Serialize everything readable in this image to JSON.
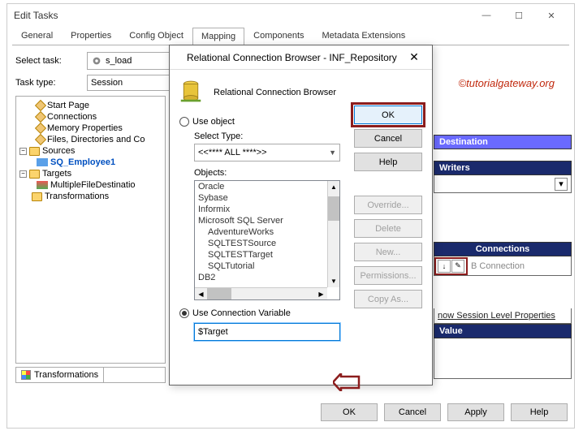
{
  "window": {
    "title": "Edit Tasks",
    "minimize": "—",
    "maximize": "☐",
    "close": "✕"
  },
  "tabs": [
    "General",
    "Properties",
    "Config Object",
    "Mapping",
    "Components",
    "Metadata Extensions"
  ],
  "active_tab": 3,
  "select_task": {
    "label": "Select task:",
    "value": "s_load"
  },
  "task_type": {
    "label": "Task type:",
    "value": "Session"
  },
  "tree": {
    "items": [
      {
        "label": "Start Page",
        "icon": "diamond",
        "indent": 1
      },
      {
        "label": "Connections",
        "icon": "diamond",
        "indent": 1
      },
      {
        "label": "Memory Properties",
        "icon": "diamond",
        "indent": 1
      },
      {
        "label": "Files, Directories and Co",
        "icon": "diamond",
        "indent": 1
      },
      {
        "label": "Sources",
        "icon": "folder",
        "indent": 0,
        "exp": "-"
      },
      {
        "label": "SQ_Employee1",
        "icon": "sq",
        "indent": 1,
        "blue": true
      },
      {
        "label": "Targets",
        "icon": "folder",
        "indent": 0,
        "exp": "-"
      },
      {
        "label": "MultipleFileDestinatio",
        "icon": "tgt",
        "indent": 1
      },
      {
        "label": "Transformations",
        "icon": "folder",
        "indent": 0
      }
    ]
  },
  "lower_tab": "Transformations",
  "right": {
    "destination": "Destination",
    "writers": "Writers",
    "connections": "Connections",
    "conn_text": "B Connection",
    "show_props": "now Session Level Properties",
    "value": "Value"
  },
  "buttons": {
    "ok": "OK",
    "cancel": "Cancel",
    "apply": "Apply",
    "help": "Help"
  },
  "watermark": "©tutorialgateway.org",
  "modal": {
    "title": "Relational Connection Browser - INF_Repository",
    "header": "Relational Connection Browser",
    "use_object": "Use object",
    "select_type_lbl": "Select Type:",
    "select_type_val": "<<**** ALL ****>>",
    "objects_lbl": "Objects:",
    "objects": [
      "Oracle",
      "Sybase",
      "Informix",
      "Microsoft SQL Server",
      "AdventureWorks",
      "SQLTESTSource",
      "SQLTESTTarget",
      "SQLTutorial",
      "DB2"
    ],
    "use_conn_var": "Use Connection Variable",
    "conn_var_val": "$Target",
    "btns": {
      "ok": "OK",
      "cancel": "Cancel",
      "help": "Help",
      "override": "Override...",
      "delete": "Delete",
      "new": "New...",
      "perms": "Permissions...",
      "copy": "Copy As..."
    }
  }
}
